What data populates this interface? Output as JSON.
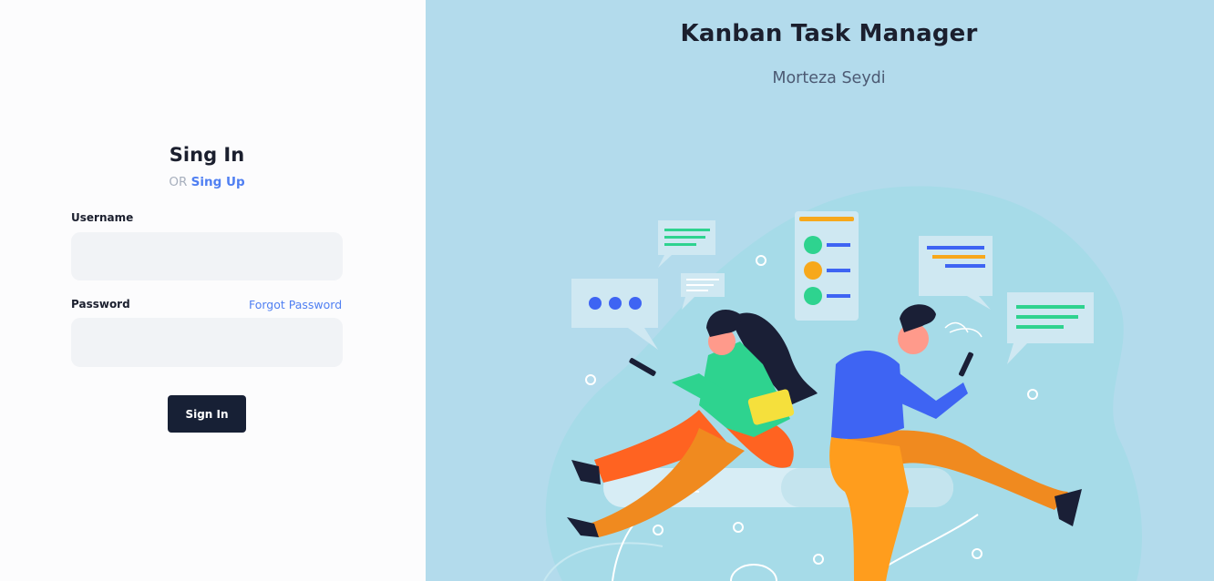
{
  "signin": {
    "title": "Sing In",
    "alt_prefix": "OR",
    "alt_link": "Sing Up",
    "username_label": "Username",
    "username_value": "",
    "password_label": "Password",
    "password_value": "",
    "forgot_link": "Forgot Password",
    "submit_label": "Sign In"
  },
  "hero": {
    "title": "Kanban Task Manager",
    "author": "Morteza Seydi",
    "illustration": "two-people-chatting-on-phones-illustration"
  },
  "colors": {
    "panel_bg": "#fcfcfd",
    "hero_bg": "#b3dbec",
    "accent": "#4f7ff2",
    "button_bg": "#172035",
    "input_bg": "#f1f3f6"
  }
}
